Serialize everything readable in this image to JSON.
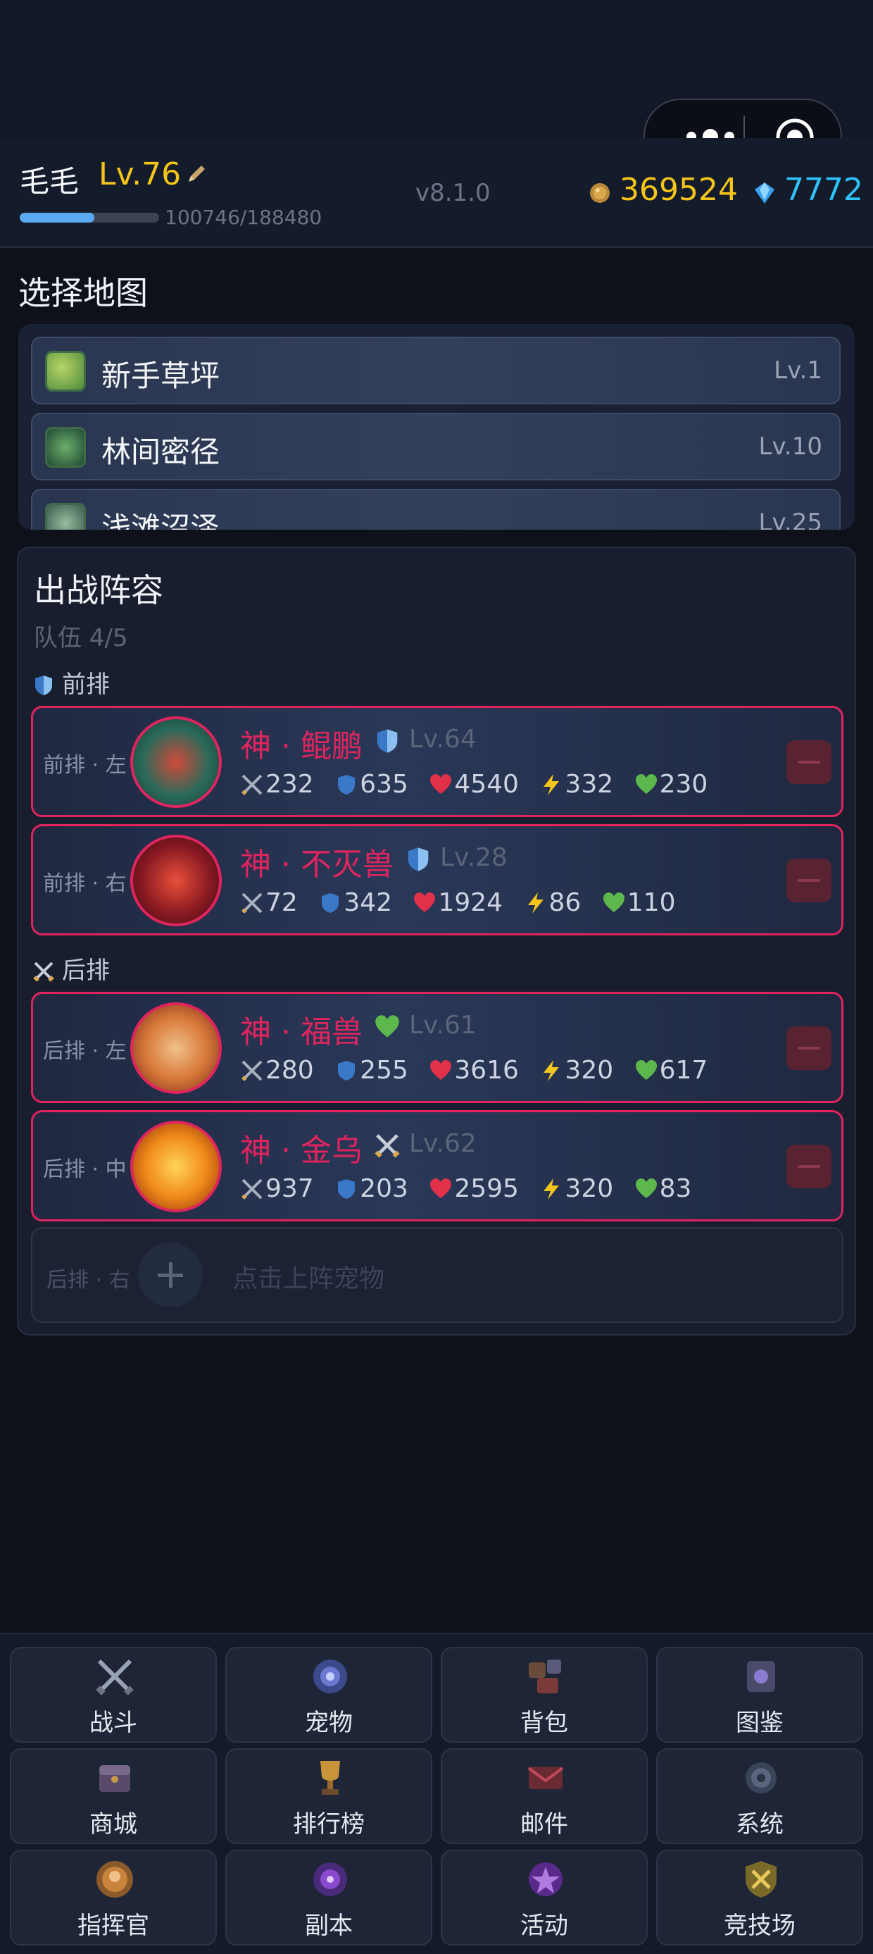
{
  "header": {
    "name": "毛毛",
    "level": "Lv.76",
    "xp_text": "100746/188480",
    "xp_fraction": 0.534,
    "version": "v8.1.0",
    "coins": "369524",
    "gems": "7772"
  },
  "maps": {
    "title": "选择地图",
    "items": [
      {
        "name": "新手草坪",
        "level": "Lv.1"
      },
      {
        "name": "林间密径",
        "level": "Lv.10"
      },
      {
        "name": "浅滩沼泽",
        "level": "Lv.25"
      }
    ]
  },
  "team": {
    "title": "出战阵容",
    "count": "队伍 4/5",
    "front_label": "前排",
    "back_label": "后排",
    "pets": [
      {
        "slot": "前排 · 左",
        "name": "神 · 鲲鹏",
        "level": "Lv.64",
        "type": "shield",
        "atk": "232",
        "def": "635",
        "hp": "4540",
        "spd": "332",
        "heal": "230"
      },
      {
        "slot": "前排 · 右",
        "name": "神 · 不灭兽",
        "level": "Lv.28",
        "type": "shield",
        "atk": "72",
        "def": "342",
        "hp": "1924",
        "spd": "86",
        "heal": "110"
      },
      {
        "slot": "后排 · 左",
        "name": "神 · 福兽",
        "level": "Lv.61",
        "type": "heart",
        "atk": "280",
        "def": "255",
        "hp": "3616",
        "spd": "320",
        "heal": "617"
      },
      {
        "slot": "后排 · 中",
        "name": "神 · 金乌",
        "level": "Lv.62",
        "type": "swords",
        "atk": "937",
        "def": "203",
        "hp": "2595",
        "spd": "320",
        "heal": "83"
      }
    ],
    "empty_slot": "后排 · 右",
    "empty_hint": "点击上阵宠物"
  },
  "nav": [
    {
      "label": "战斗",
      "icon": "crossed-swords-icon"
    },
    {
      "label": "宠物",
      "icon": "pet-orb-icon"
    },
    {
      "label": "背包",
      "icon": "backpack-icon"
    },
    {
      "label": "图鉴",
      "icon": "codex-book-icon"
    },
    {
      "label": "商城",
      "icon": "shop-chest-icon"
    },
    {
      "label": "排行榜",
      "icon": "trophy-icon"
    },
    {
      "label": "邮件",
      "icon": "mail-icon"
    },
    {
      "label": "系统",
      "icon": "gear-icon"
    },
    {
      "label": "指挥官",
      "icon": "commander-icon"
    },
    {
      "label": "副本",
      "icon": "dungeon-portal-icon"
    },
    {
      "label": "活动",
      "icon": "event-icon"
    },
    {
      "label": "竞技场",
      "icon": "arena-icon"
    }
  ],
  "colors": {
    "accent_pink": "#e0245e",
    "gold": "#f5c518",
    "gem_blue": "#2ec4ff"
  }
}
